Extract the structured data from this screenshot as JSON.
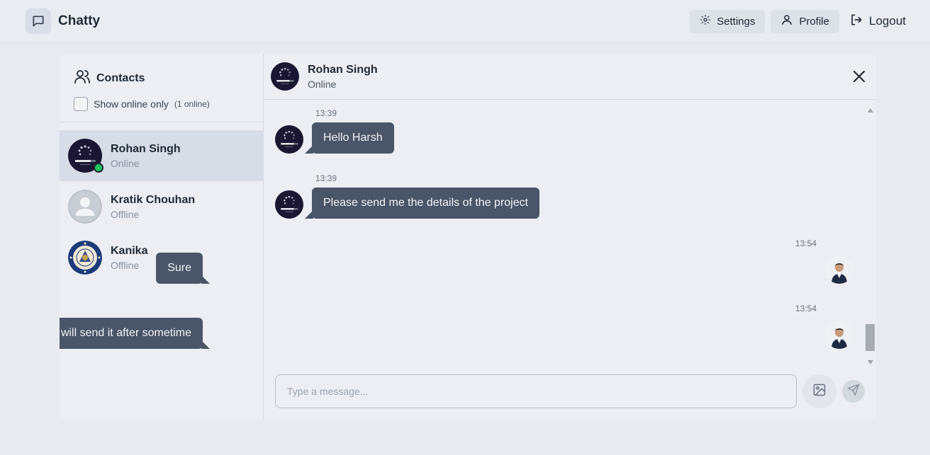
{
  "app": {
    "name": "Chatty"
  },
  "nav": {
    "settings": "Settings",
    "profile": "Profile",
    "logout": "Logout"
  },
  "sidebar": {
    "title": "Contacts",
    "filter_label": "Show online only",
    "online_count": "(1 online)",
    "contacts": [
      {
        "name": "Rohan Singh",
        "status": "Online",
        "avatar": "loading-avatar"
      },
      {
        "name": "Kratik Chouhan",
        "status": "Offline",
        "avatar": "default-user-avatar"
      },
      {
        "name": "Kanika",
        "status": "Offline",
        "avatar": "emblem-avatar"
      }
    ]
  },
  "chat": {
    "name": "Rohan Singh",
    "status": "Online",
    "messages": [
      {
        "time": "13:39",
        "text": "Hello Harsh",
        "direction": "incoming"
      },
      {
        "time": "13:39",
        "text": "Please send me the details of the project",
        "direction": "incoming"
      },
      {
        "time": "13:54",
        "text": "Sure",
        "direction": "outgoing"
      },
      {
        "time": "13:54",
        "text": "I will send it after sometime",
        "direction": "outgoing"
      }
    ],
    "input_placeholder": "Type a message..."
  },
  "colors": {
    "bubble": "#4a5568",
    "online": "#22c55e",
    "active_contact": "#d7dce6"
  }
}
